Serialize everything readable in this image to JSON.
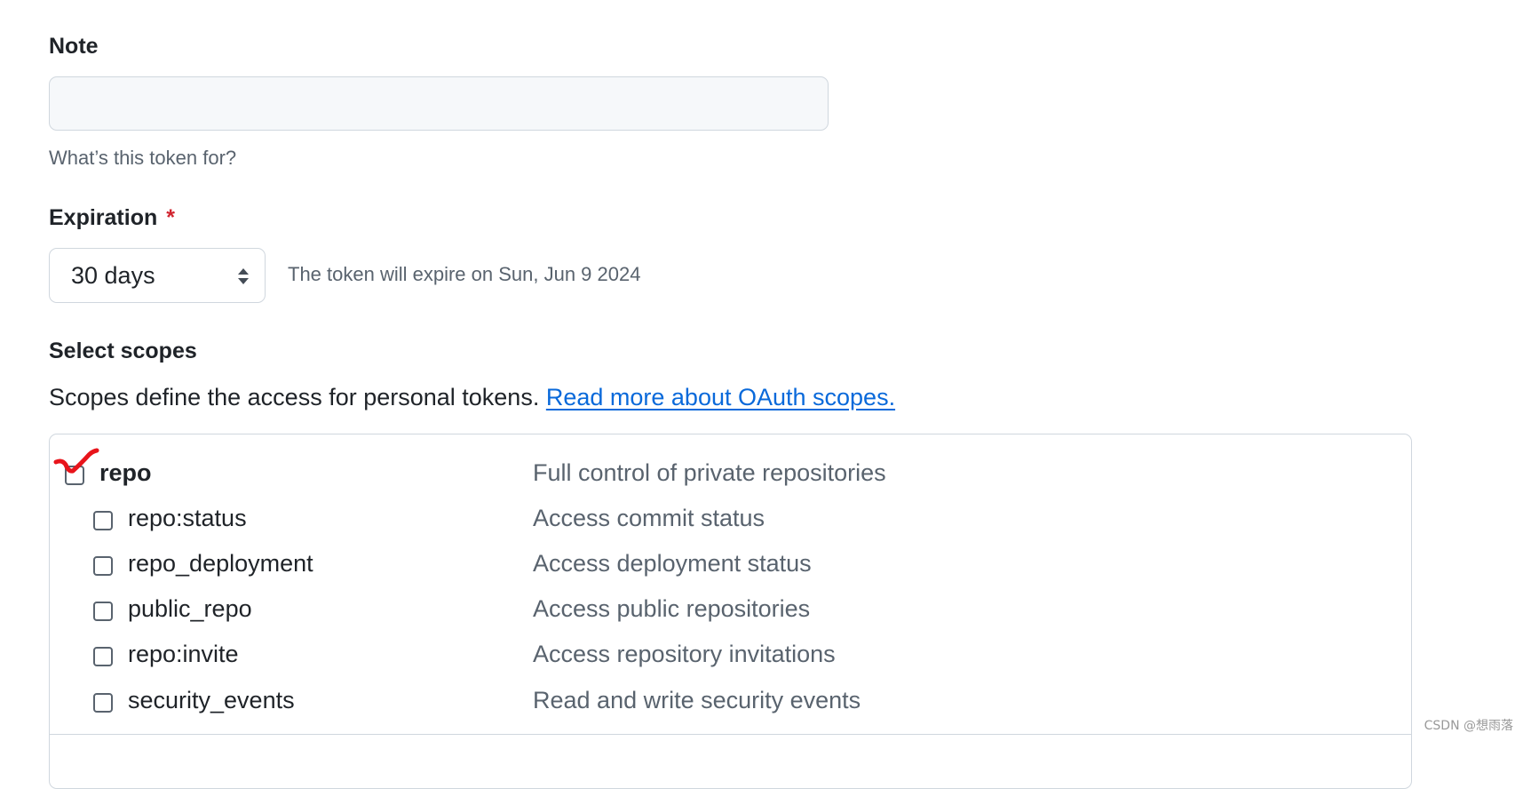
{
  "note": {
    "label": "Note",
    "value": "",
    "placeholder": "",
    "hint": "What’s this token for?"
  },
  "expiration": {
    "label": "Expiration",
    "required_mark": "*",
    "selected": "30 days",
    "info": "The token will expire on Sun, Jun 9 2024"
  },
  "scopes": {
    "heading": "Select scopes",
    "description": "Scopes define the access for personal tokens.",
    "link_label": "Read more about OAuth scopes.",
    "items": [
      {
        "name": "repo",
        "description": "Full control of private repositories",
        "checked": true
      },
      {
        "name": "repo:status",
        "description": "Access commit status",
        "checked": false
      },
      {
        "name": "repo_deployment",
        "description": "Access deployment status",
        "checked": false
      },
      {
        "name": "public_repo",
        "description": "Access public repositories",
        "checked": false
      },
      {
        "name": "repo:invite",
        "description": "Access repository invitations",
        "checked": false
      },
      {
        "name": "security_events",
        "description": "Read and write security events",
        "checked": false
      }
    ]
  },
  "annotation": {
    "mark_color": "#e8141b"
  },
  "watermark": "CSDN @想雨落"
}
